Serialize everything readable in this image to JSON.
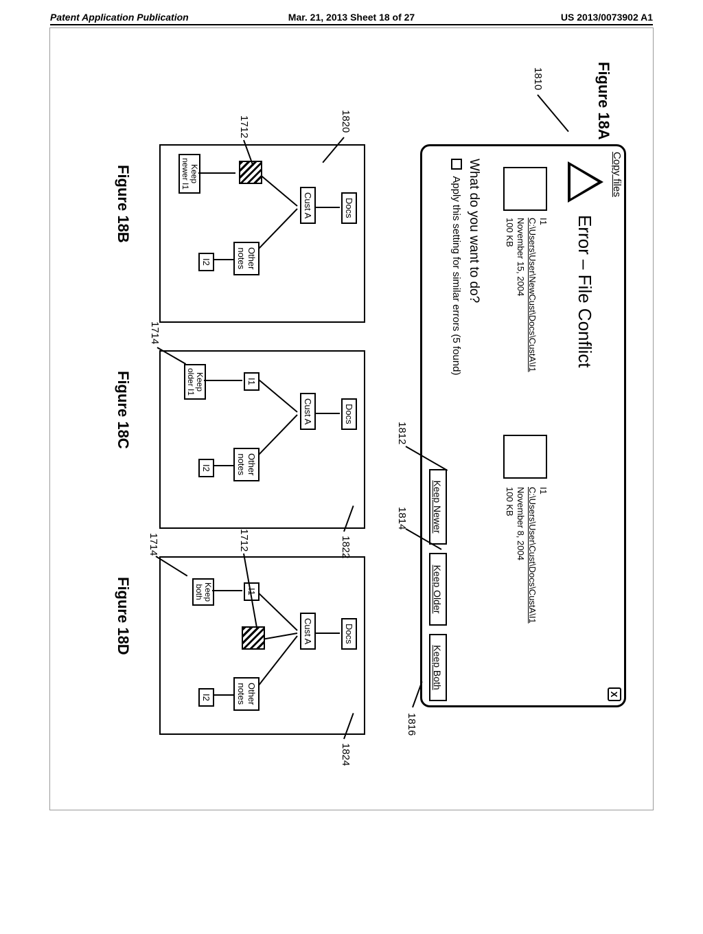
{
  "header": {
    "left": "Patent Application Publication",
    "mid": "Mar. 21, 2013  Sheet 18 of 27",
    "right": "US 2013/0073902 A1"
  },
  "fig18A": {
    "label": "Figure 18A",
    "ref": "1810",
    "dialog": {
      "title": "Copy files",
      "close": "X",
      "heading": "Error – File Conflict",
      "file_left": {
        "name": "I1",
        "path": "C:\\Users\\User\\NewCust\\Docs\\CustA\\I1",
        "date": "November 15, 2004",
        "size": "100 KB"
      },
      "file_right": {
        "name": "I1",
        "path": "C:\\Users\\User\\Cust\\Docs\\CustA\\I1",
        "date": "November 8, 2004",
        "size": "100 KB"
      },
      "prompt": "What do you want to do?",
      "apply_label": "Apply this setting for similar errors (5 found)",
      "buttons": {
        "newer": "Keep Newer",
        "older": "Keep Older",
        "both": "Keep Both"
      },
      "refs": {
        "newer": "1812",
        "older": "1814",
        "both": "1816"
      }
    }
  },
  "trees": {
    "docs": "Docs",
    "custA": "Cust A",
    "i1": "I1",
    "other_notes": "Other\nnotes",
    "i2": "I2"
  },
  "fig18B": {
    "label": "Figure 18B",
    "panel_ref": "1820",
    "hatched_ref": "1712",
    "caption": "Keep\nnewer I1"
  },
  "fig18C": {
    "label": "Figure 18C",
    "caption": "Keep\nolder I1",
    "i1_ref": "1714",
    "panel_ref": "1822"
  },
  "fig18D": {
    "label": "Figure 18D",
    "panel_ref": "1824",
    "hatched_ref": "1712",
    "i1_ref": "1714",
    "caption": "Keep\nboth"
  }
}
